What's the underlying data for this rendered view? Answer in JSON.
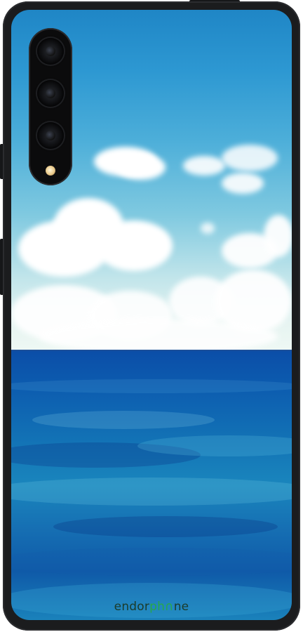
{
  "brand": {
    "part1": "endor",
    "part2": "ph",
    "part3": "ne",
    "glyph": "∩",
    "colors": {
      "part1": "#1b3b2a",
      "part2": "#27a84a",
      "part3": "#1b3b2a"
    }
  },
  "case": {
    "color": "#1b1c1e"
  },
  "scene": {
    "sky": "sky",
    "sea": "sea"
  }
}
